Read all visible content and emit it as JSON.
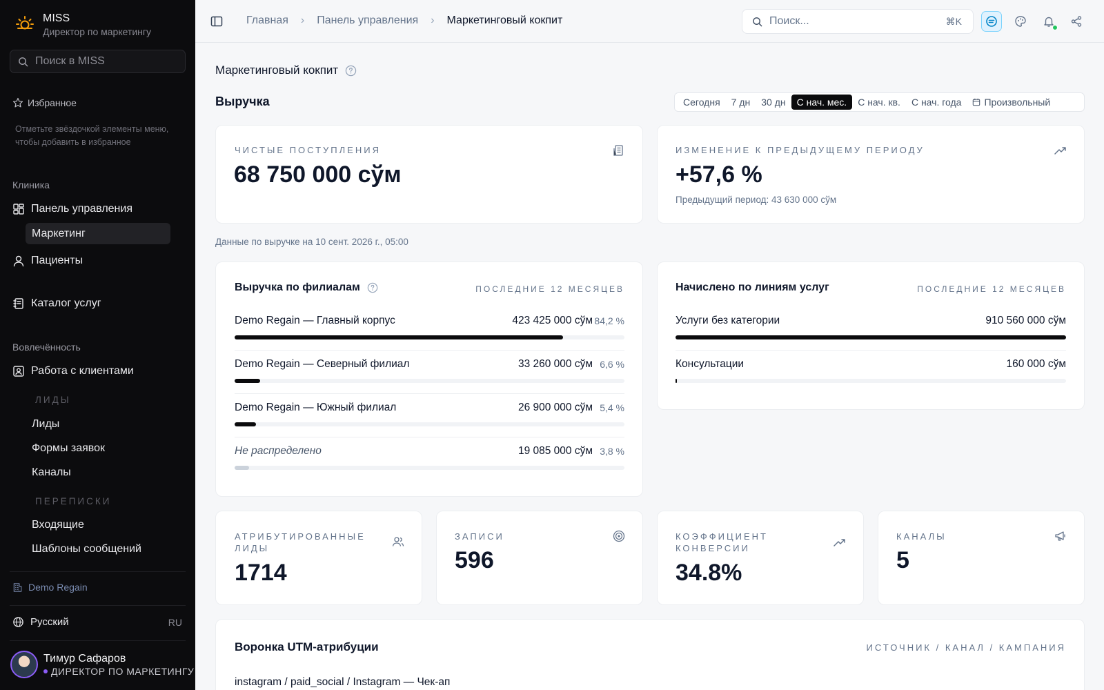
{
  "sidebar": {
    "brand_name": "MISS",
    "brand_role": "Директор по маркетингу",
    "search_placeholder": "Поиск в MISS",
    "favorites_title": "Избранное",
    "favorites_hint": "Отметьте звёздочкой элементы меню, чтобы добавить в избранное",
    "section_clinic": "Клиника",
    "dashboard": "Панель управления",
    "marketing": "Маркетинг",
    "patients": "Пациенты",
    "catalog": "Каталог услуг",
    "section_engagement": "Вовлечённость",
    "client_work": "Работа с клиентами",
    "group_leads": "ЛИДЫ",
    "leads": "Лиды",
    "forms": "Формы заявок",
    "channels": "Каналы",
    "group_messages": "ПЕРЕПИСКИ",
    "inbox": "Входящие",
    "templates": "Шаблоны сообщений",
    "org": "Demo Regain",
    "language": "Русский",
    "language_code": "RU",
    "user_name": "Тимур Сафаров",
    "user_role": "ДИРЕКТОР ПО МАРКЕТИНГУ"
  },
  "topbar": {
    "breadcrumbs": [
      "Главная",
      "Панель управления",
      "Маркетинговый кокпит"
    ],
    "search_placeholder": "Поиск...",
    "shortcut": "⌘K"
  },
  "main": {
    "page_title": "Маркетинговый кокпит",
    "revenue_title": "Выручка",
    "periods": [
      "Сегодня",
      "7 дн",
      "30 дн",
      "С нач. мес.",
      "С нач. кв.",
      "С нач. года",
      "Произвольный"
    ],
    "active_period": "С нач. мес.",
    "net_income_label": "ЧИСТЫЕ ПОСТУПЛЕНИЯ",
    "net_income_value": "68 750 000 сўм",
    "change_label": "ИЗМЕНЕНИЕ К ПРЕДЫДУЩЕМУ ПЕРИОДУ",
    "change_value": "+57,6 %",
    "previous_period": "Предыдущий период: 43 630 000 сўм",
    "data_note": "Данные по выручке на 10 сент. 2026 г., 05:00",
    "branches": {
      "title": "Выручка по филиалам",
      "range": "ПОСЛЕДНИЕ 12 МЕСЯЦЕВ",
      "rows": [
        {
          "label": "Demo Regain — Главный корпус",
          "value": "423 425 000 сўм",
          "pct": "84,2 %",
          "share": 0.842
        },
        {
          "label": "Demo Regain — Северный филиал",
          "value": "33 260 000 сўм",
          "pct": "6,6 %",
          "share": 0.066
        },
        {
          "label": "Demo Regain — Южный филиал",
          "value": "26 900 000 сўм",
          "pct": "5,4 %",
          "share": 0.054
        },
        {
          "label": "Не распределено",
          "value": "19 085 000 сўм",
          "pct": "3,8 %",
          "share": 0.038
        }
      ]
    },
    "service_lines": {
      "title": "Начислено по линиям услуг",
      "range": "ПОСЛЕДНИЕ 12 МЕСЯЦЕВ",
      "rows": [
        {
          "label": "Услуги без категории",
          "value": "910 560 000 сўм",
          "share": 1.0
        },
        {
          "label": "Консультации",
          "value": "160 000 сўм",
          "share": 0.002
        }
      ]
    },
    "kpis": [
      {
        "label": "АТРИБУТИРОВАННЫЕ ЛИДЫ",
        "value": "1714",
        "icon": "users-icon"
      },
      {
        "label": "ЗАПИСИ",
        "value": "596",
        "icon": "target-icon"
      },
      {
        "label": "КОЭФФИЦИЕНТ КОНВЕРСИИ",
        "value": "34.8%",
        "icon": "trend-up-icon"
      },
      {
        "label": "КАНАЛЫ",
        "value": "5",
        "icon": "megaphone-icon"
      }
    ],
    "utm": {
      "title": "Воронка UTM-атрибуции",
      "range": "ИСТОЧНИК / КАНАЛ / КАМПАНИЯ",
      "first_row": "instagram / paid_social / Instagram — Чек-ап"
    }
  }
}
